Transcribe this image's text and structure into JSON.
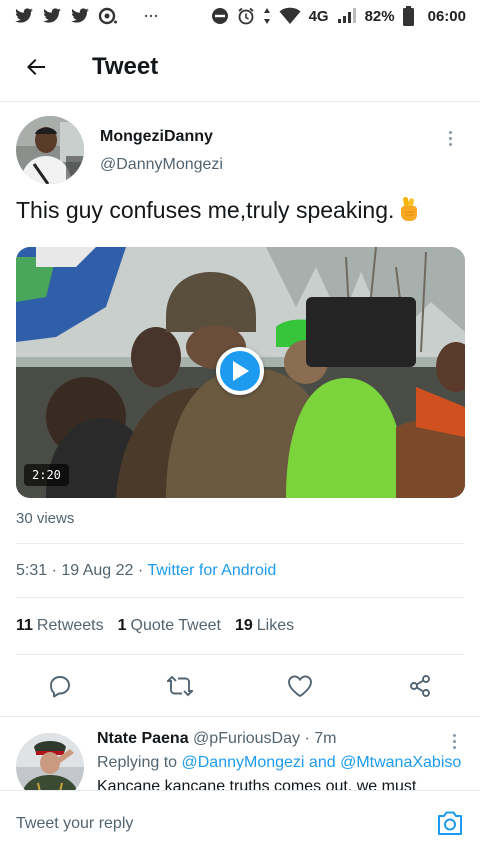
{
  "status_bar": {
    "network": "4G",
    "battery": "82%",
    "time": "06:00"
  },
  "header": {
    "title": "Tweet"
  },
  "tweet": {
    "author_name": "MongeziDanny",
    "author_handle": "@DannyMongezi",
    "text": "This guy confuses me,truly speaking.",
    "emoji": "crossed-fingers-emoji",
    "video_duration": "2:20",
    "views": "30 views",
    "timestamp": "5:31 · 19 Aug 22 · ",
    "source": "Twitter for Android",
    "stats": {
      "retweets_count": "11",
      "retweets_label": "Retweets",
      "quotes_count": "1",
      "quotes_label": "Quote Tweet",
      "likes_count": "19",
      "likes_label": "Likes"
    }
  },
  "actions": [
    "reply-icon",
    "retweet-icon",
    "like-icon",
    "share-icon"
  ],
  "reply": {
    "author_name": "Ntate Paena",
    "author_handle": "@pFuriousDay",
    "time": "· 7m",
    "replying_prefix": "Replying to",
    "replying_to_1": "@DannyMongezi",
    "replying_joiner": "and",
    "replying_to_2": "@MtwanaXabiso",
    "text": "Kancane kancane truths comes out, we must"
  },
  "composer": {
    "placeholder": "Tweet your reply"
  },
  "colors": {
    "accent": "#1d9bf0",
    "text": "#14171a",
    "muted": "#536471",
    "divider": "#e6ecf0"
  }
}
